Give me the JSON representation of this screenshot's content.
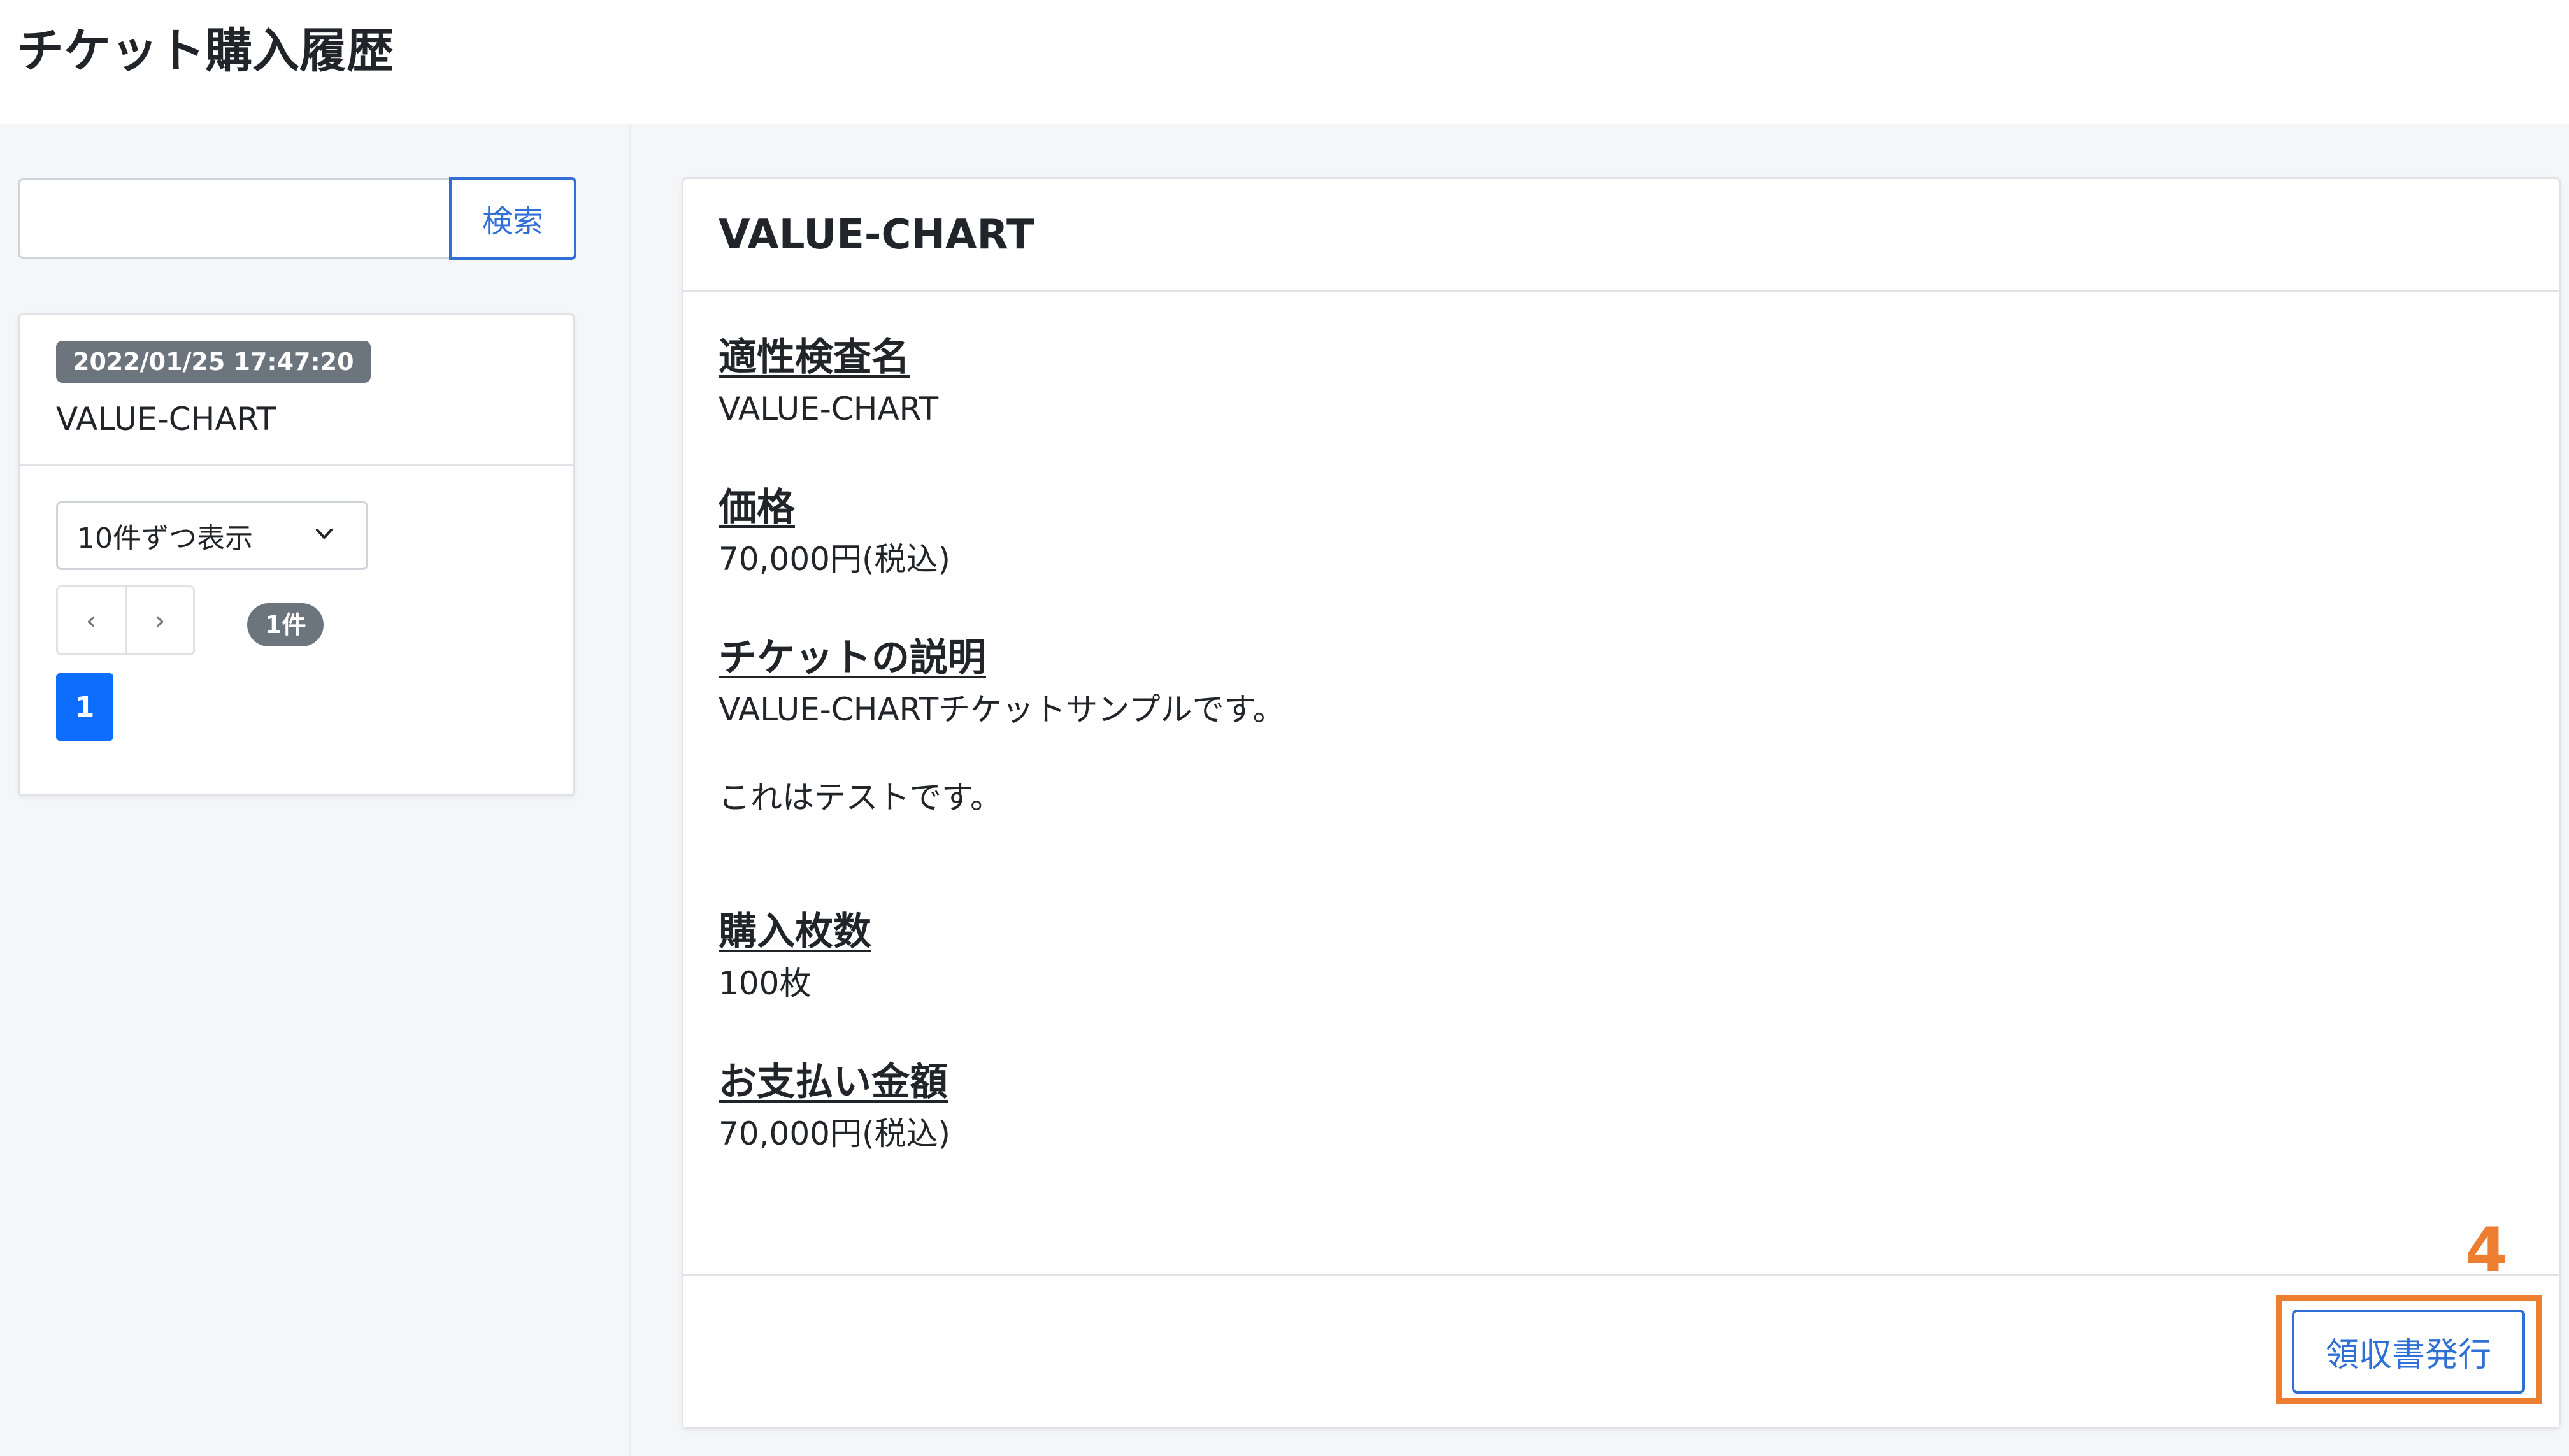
{
  "page": {
    "title": "チケット購入履歴"
  },
  "search": {
    "value": "",
    "placeholder": "",
    "button_label": "検索"
  },
  "ticket_list": {
    "items": [
      {
        "date": "2022/01/25 17:47:20",
        "name": "VALUE-CHART"
      }
    ],
    "per_page_label": "10件ずつ表示",
    "prev_label": "‹",
    "next_label": "›",
    "count_label": "1件",
    "current_page": "1"
  },
  "detail": {
    "title": "VALUE-CHART",
    "fields": [
      {
        "label": "適性検査名",
        "value": "VALUE-CHART"
      },
      {
        "label": "価格",
        "value": "70,000円(税込)"
      },
      {
        "label": "チケットの説明",
        "value": "VALUE-CHARTチケットサンプルです。",
        "value2": "これはテストです。"
      },
      {
        "label": "購入枚数",
        "value": "100枚"
      },
      {
        "label": "お支払い金額",
        "value": "70,000円(税込)"
      }
    ],
    "receipt_button_label": "領収書発行"
  },
  "annotation": {
    "step_number": "4",
    "color": "#ed7d31"
  },
  "colors": {
    "primary": "#0d6efd",
    "outline_blue": "#2f6fd6",
    "badge_gray": "#6c757d",
    "background": "#f5f6f8"
  }
}
